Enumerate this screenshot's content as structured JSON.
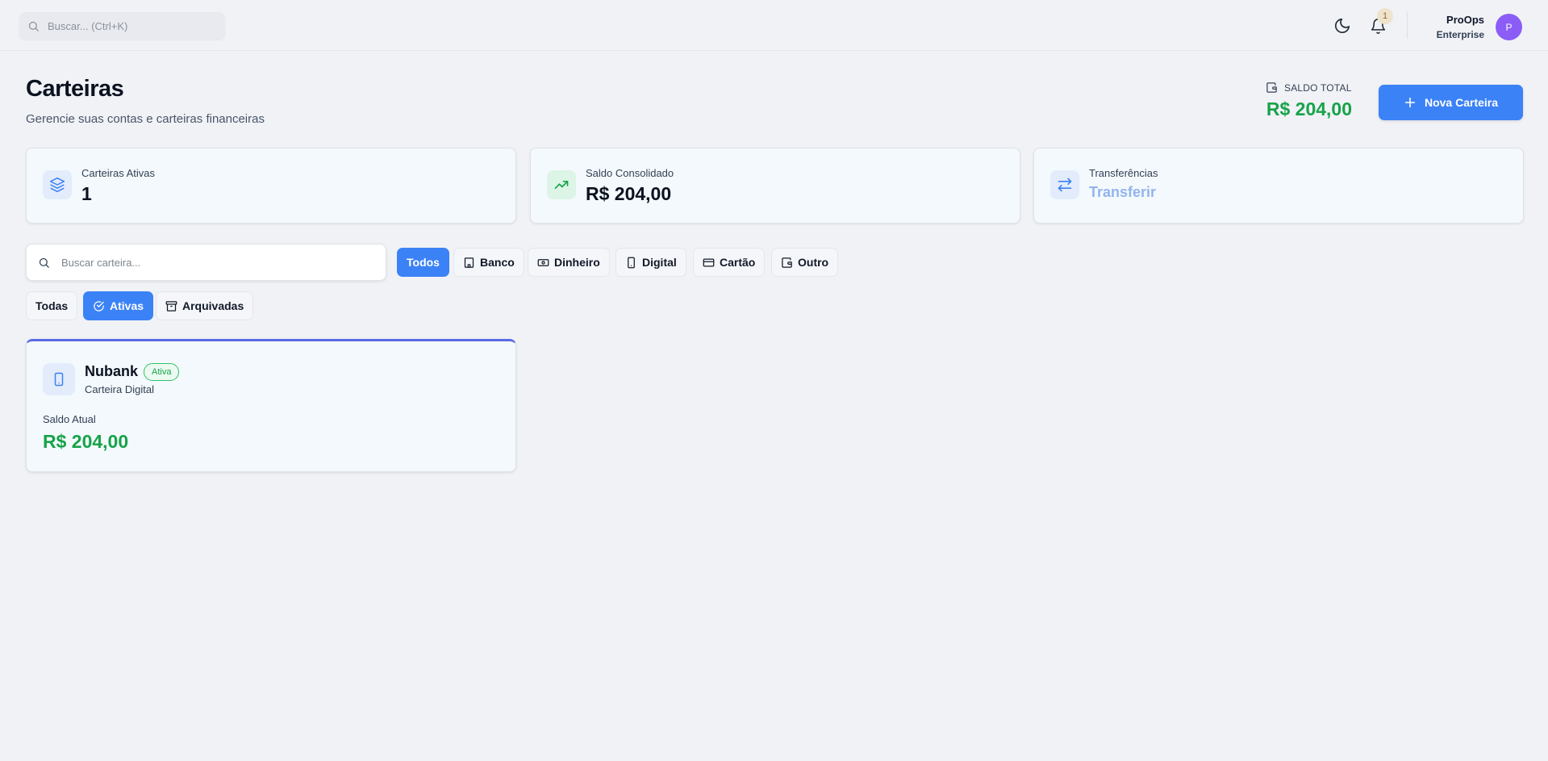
{
  "topbar": {
    "search_placeholder": "Buscar... (Ctrl+K)",
    "notification_count": "1",
    "user_name": "ProOps",
    "user_plan": "Enterprise",
    "avatar_initial": "P"
  },
  "header": {
    "title": "Carteiras",
    "subtitle": "Gerencie suas contas e carteiras financeiras",
    "saldo_total_label": "SALDO TOTAL",
    "saldo_total_value": "R$ 204,00",
    "new_wallet_label": "Nova Carteira"
  },
  "stats": [
    {
      "label": "Carteiras Ativas",
      "value": "1",
      "icon": "layers-icon"
    },
    {
      "label": "Saldo Consolidado",
      "value": "R$ 204,00",
      "icon": "trending-up-icon"
    },
    {
      "label": "Transferências",
      "value": "Transferir",
      "icon": "transfer-icon"
    }
  ],
  "filters": {
    "search_placeholder": "Buscar carteira...",
    "types": [
      {
        "label": "Todos",
        "active": true
      },
      {
        "label": "Banco",
        "icon": "bank-icon"
      },
      {
        "label": "Dinheiro",
        "icon": "cash-icon"
      },
      {
        "label": "Digital",
        "icon": "phone-icon"
      },
      {
        "label": "Cartão",
        "icon": "card-icon"
      },
      {
        "label": "Outro",
        "icon": "wallet-icon"
      }
    ],
    "status": [
      {
        "label": "Todas"
      },
      {
        "label": "Ativas",
        "icon": "check-circle-icon",
        "active": true
      },
      {
        "label": "Arquivadas",
        "icon": "archive-icon"
      }
    ]
  },
  "wallets": [
    {
      "name": "Nubank",
      "status": "Ativa",
      "type": "Carteira Digital",
      "balance_label": "Saldo Atual",
      "balance": "R$ 204,00",
      "icon": "phone-icon"
    }
  ],
  "colors": {
    "accent": "#3b82f6",
    "positive": "#16a34a",
    "avatar": "#8b5cf6",
    "card_top_border": "#5b6ae6"
  }
}
